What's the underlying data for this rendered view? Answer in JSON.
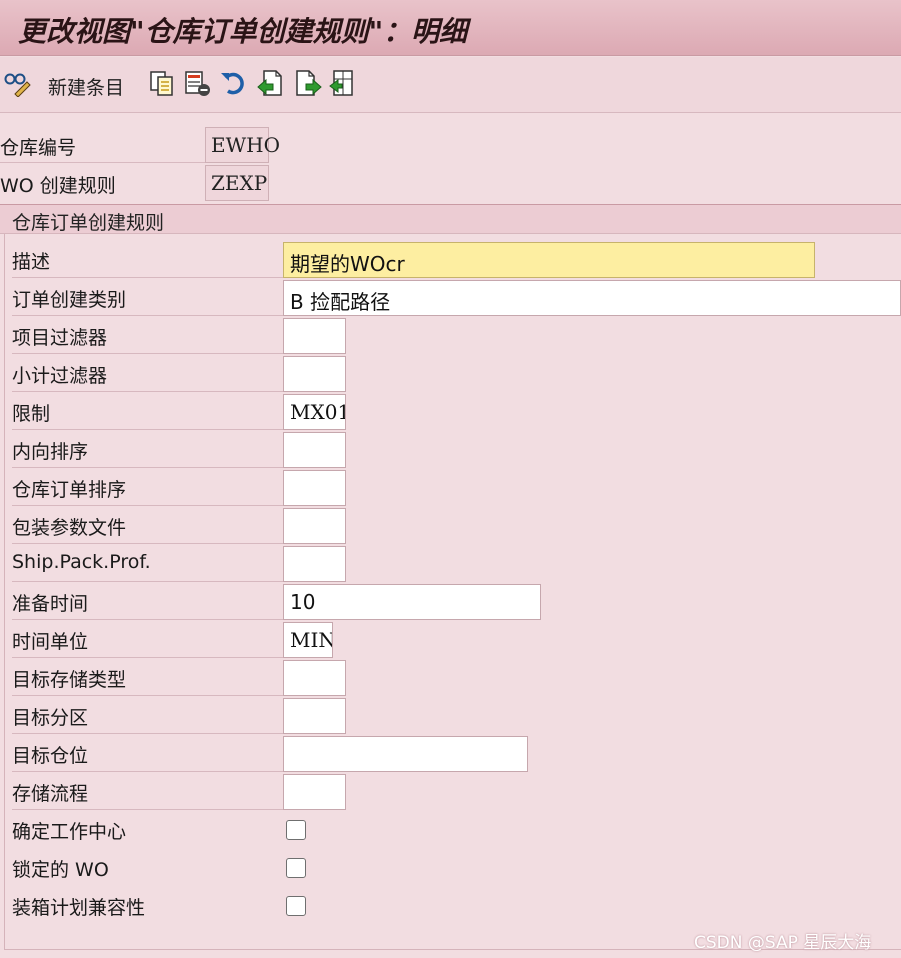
{
  "window": {
    "title": "更改视图\"仓库订单创建规则\"：明细"
  },
  "toolbar": {
    "new_entries_label": "新建条目",
    "icons": [
      "glasses-pencil-icon",
      "copy-icon",
      "delete-icon",
      "undo-icon",
      "previous-entry-icon",
      "next-entry-icon",
      "select-icon"
    ]
  },
  "header": {
    "warehouse_label": "仓库编号",
    "warehouse_value": "EWHO",
    "rule_label": "WO 创建规则",
    "rule_value": "ZEXP"
  },
  "section": {
    "title": "仓库订单创建规则"
  },
  "form": {
    "description_label": "描述",
    "description_value": "期望的WOcr",
    "order_type_label": "订单创建类别",
    "order_type_value": "B 捡配路径",
    "item_filter_label": "项目过滤器",
    "item_filter_value": "",
    "subtotal_filter_label": "小计过滤器",
    "subtotal_filter_value": "",
    "limit_label": "限制",
    "limit_value": "MX01",
    "inbound_sort_label": "内向排序",
    "inbound_sort_value": "",
    "wo_sort_label": "仓库订单排序",
    "wo_sort_value": "",
    "pack_profile_label": "包装参数文件",
    "pack_profile_value": "",
    "ship_pack_label": "Ship.Pack.Prof.",
    "ship_pack_value": "",
    "prep_time_label": "准备时间",
    "prep_time_value": "10",
    "time_unit_label": "时间单位",
    "time_unit_value": "MIN",
    "target_storage_type_label": "目标存储类型",
    "target_storage_type_value": "",
    "target_area_label": "目标分区",
    "target_area_value": "",
    "target_bin_label": "目标仓位",
    "target_bin_value": "",
    "storage_process_label": "存储流程",
    "storage_process_value": "",
    "determine_wc_label": "确定工作中心",
    "determine_wc_checked": false,
    "locked_wo_label": "锁定的 WO",
    "locked_wo_checked": false,
    "packing_compat_label": "装箱计划兼容性",
    "packing_compat_checked": false
  },
  "watermark": "CSDN @SAP 星辰大海"
}
